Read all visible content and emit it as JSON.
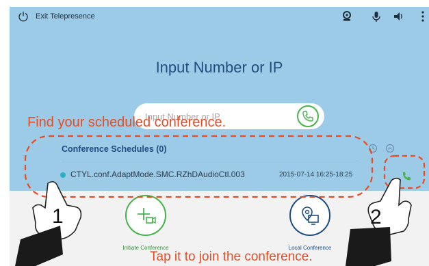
{
  "topbar": {
    "exit_label": "Exit Telepresence",
    "icons": [
      "power-icon",
      "camera-icon",
      "microphone-icon",
      "speaker-icon",
      "more-vertical-icon"
    ]
  },
  "main": {
    "title": "Input Number or IP",
    "search_placeholder": "Input Number or IP"
  },
  "schedules": {
    "header": "Conference Schedules (0)",
    "items": [
      {
        "name": "CTYL.conf.AdaptMode.SMC.RZhDAudioCtl.003",
        "time": "2015-07-14 16:25-18:25"
      }
    ]
  },
  "actions": {
    "initiate_label": "Initiate Conference",
    "local_label": "Local Conference"
  },
  "annotations": {
    "find_text": "Find your scheduled conference.",
    "tap_text": "Tap it to join the conference.",
    "step1": "1",
    "step2": "2"
  },
  "colors": {
    "panel_blue": "#9ccbe7",
    "title_blue": "#1e4d82",
    "accent_green": "#46b24a",
    "annotation_red": "#e84b24"
  }
}
